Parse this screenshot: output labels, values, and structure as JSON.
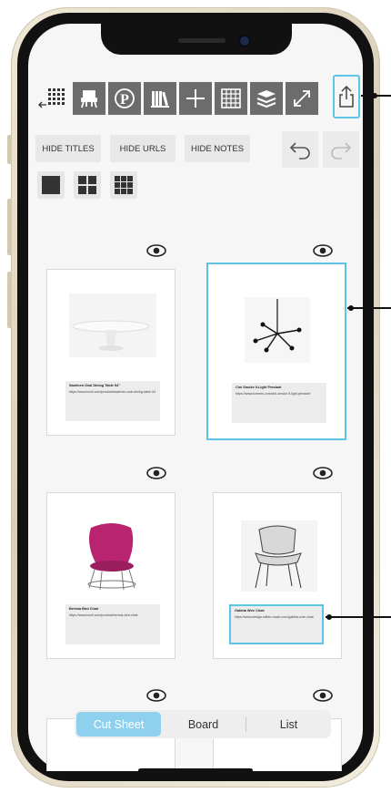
{
  "toolbar": {
    "icons": [
      "grid-back-icon",
      "chair-icon",
      "pinterest-icon",
      "library-icon",
      "plus-icon",
      "grid-icon",
      "layers-icon",
      "expand-icon",
      "share-icon"
    ],
    "accent": "#5ec4e6",
    "button_color": "#6c6c6c"
  },
  "actions": {
    "hide_titles": "HIDE TITLES",
    "hide_urls": "HIDE URLS",
    "hide_notes": "HIDE NOTES"
  },
  "layout_options": [
    "single-column-icon",
    "two-by-two-icon",
    "three-by-three-icon"
  ],
  "cards": [
    {
      "title": "Saarinen Oval Dining Table 54\"",
      "url": "https://www.knoll.com/product/saarinen-oval-dining-table-54",
      "selected": false
    },
    {
      "title": "Cini Smoke 9-Light Pendant",
      "url": "https://www.lumens.com/cini-smoke-9-light-pendant",
      "selected": true
    },
    {
      "title": "Bertoia Bird Chair",
      "url": "https://www.knoll.com/product/bertoia-bird-chair",
      "selected": false
    },
    {
      "title": "Gabbia Wire Chair",
      "url": "https://www.design-within-reach.com/gabbia-wire-chair",
      "selected": false
    }
  ],
  "tabs": {
    "items": [
      "Cut Sheet",
      "Board",
      "List"
    ],
    "active": "Cut Sheet"
  }
}
